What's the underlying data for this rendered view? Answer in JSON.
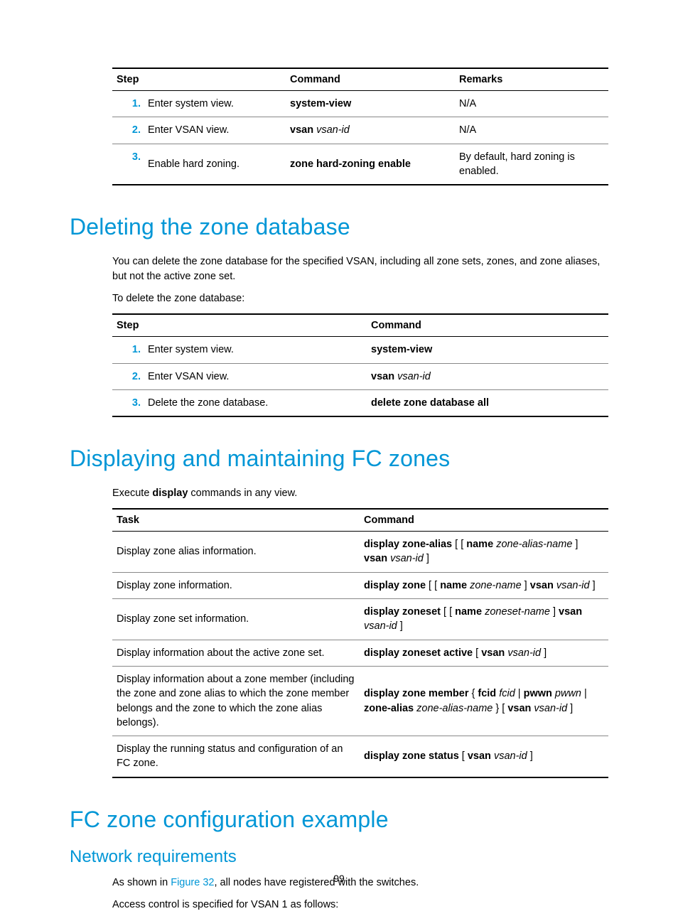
{
  "table1": {
    "headers": {
      "step": "Step",
      "command": "Command",
      "remarks": "Remarks"
    },
    "rows": [
      {
        "n": "1.",
        "step": "Enter system view.",
        "cmd_bold": "system-view",
        "cmd_it": "",
        "remarks": "N/A"
      },
      {
        "n": "2.",
        "step": "Enter VSAN view.",
        "cmd_bold": "vsan",
        "cmd_it": " vsan-id",
        "remarks": "N/A"
      },
      {
        "n": "3.",
        "step": "Enable hard zoning.",
        "cmd_bold": "zone hard-zoning enable",
        "cmd_it": "",
        "remarks": "By default, hard zoning is enabled."
      }
    ]
  },
  "h1_delete": "Deleting the zone database",
  "p_delete_1": "You can delete the zone database for the specified VSAN, including all zone sets, zones, and zone aliases, but not the active zone set.",
  "p_delete_2": "To delete the zone database:",
  "table2": {
    "headers": {
      "step": "Step",
      "command": "Command"
    },
    "rows": [
      {
        "n": "1.",
        "step": "Enter system view.",
        "cmd_bold": "system-view",
        "cmd_it": ""
      },
      {
        "n": "2.",
        "step": "Enter VSAN view.",
        "cmd_bold": "vsan",
        "cmd_it": " vsan-id"
      },
      {
        "n": "3.",
        "step": "Delete the zone database.",
        "cmd_bold": "delete zone database all",
        "cmd_it": ""
      }
    ]
  },
  "h1_display": "Displaying and maintaining FC zones",
  "p_display_pre": "Execute ",
  "p_display_bold": "display",
  "p_display_post": " commands in any view.",
  "table3": {
    "headers": {
      "task": "Task",
      "command": "Command"
    },
    "rows": [
      {
        "task": "Display zone alias information.",
        "segs": [
          {
            "t": "display zone-alias",
            "b": true
          },
          {
            "t": " [ [ "
          },
          {
            "t": "name",
            "b": true
          },
          {
            "t": " "
          },
          {
            "t": "zone-alias-name",
            "i": true
          },
          {
            "t": " ] "
          },
          {
            "t": "vsan",
            "b": true
          },
          {
            "t": " "
          },
          {
            "t": "vsan-id",
            "i": true
          },
          {
            "t": " ]"
          }
        ]
      },
      {
        "task": "Display zone information.",
        "segs": [
          {
            "t": "display zone",
            "b": true
          },
          {
            "t": " [ [ "
          },
          {
            "t": "name",
            "b": true
          },
          {
            "t": " "
          },
          {
            "t": "zone-name",
            "i": true
          },
          {
            "t": " ] "
          },
          {
            "t": "vsan",
            "b": true
          },
          {
            "t": " "
          },
          {
            "t": "vsan-id",
            "i": true
          },
          {
            "t": " ]"
          }
        ]
      },
      {
        "task": "Display zone set information.",
        "segs": [
          {
            "t": "display zoneset",
            "b": true
          },
          {
            "t": " [ [ "
          },
          {
            "t": "name",
            "b": true
          },
          {
            "t": " "
          },
          {
            "t": "zoneset-name",
            "i": true
          },
          {
            "t": " ] "
          },
          {
            "t": "vsan",
            "b": true
          },
          {
            "t": " "
          },
          {
            "t": "vsan-id",
            "i": true
          },
          {
            "t": " ]"
          }
        ]
      },
      {
        "task": "Display information about the active zone set.",
        "segs": [
          {
            "t": "display zoneset active",
            "b": true
          },
          {
            "t": " [ "
          },
          {
            "t": "vsan",
            "b": true
          },
          {
            "t": " "
          },
          {
            "t": "vsan-id",
            "i": true
          },
          {
            "t": " ]"
          }
        ]
      },
      {
        "task": "Display information about a zone member (including the zone and zone alias to which the zone member belongs and the zone to which the zone alias belongs).",
        "segs": [
          {
            "t": "display zone member",
            "b": true
          },
          {
            "t": " { "
          },
          {
            "t": "fcid",
            "b": true
          },
          {
            "t": " "
          },
          {
            "t": "fcid",
            "i": true
          },
          {
            "t": " | "
          },
          {
            "t": "pwwn",
            "b": true
          },
          {
            "t": " "
          },
          {
            "t": "pwwn",
            "i": true
          },
          {
            "t": " | "
          },
          {
            "t": "zone-alias",
            "b": true
          },
          {
            "t": " "
          },
          {
            "t": "zone-alias-name",
            "i": true
          },
          {
            "t": " } [ "
          },
          {
            "t": "vsan",
            "b": true
          },
          {
            "t": " "
          },
          {
            "t": "vsan-id",
            "i": true
          },
          {
            "t": " ]"
          }
        ]
      },
      {
        "task": "Display the running status and configuration of an FC zone.",
        "segs": [
          {
            "t": "display zone status",
            "b": true
          },
          {
            "t": " [ "
          },
          {
            "t": "vsan",
            "b": true
          },
          {
            "t": " "
          },
          {
            "t": "vsan-id",
            "i": true
          },
          {
            "t": " ]"
          }
        ]
      }
    ]
  },
  "h1_example": "FC zone configuration example",
  "h2_netreq": "Network requirements",
  "p_netreq_pre": "As shown in ",
  "p_netreq_link": "Figure 32",
  "p_netreq_post": ", all nodes have registered with the switches.",
  "p_netreq_2": "Access control is specified for VSAN 1 as follows:",
  "page_number": "99"
}
